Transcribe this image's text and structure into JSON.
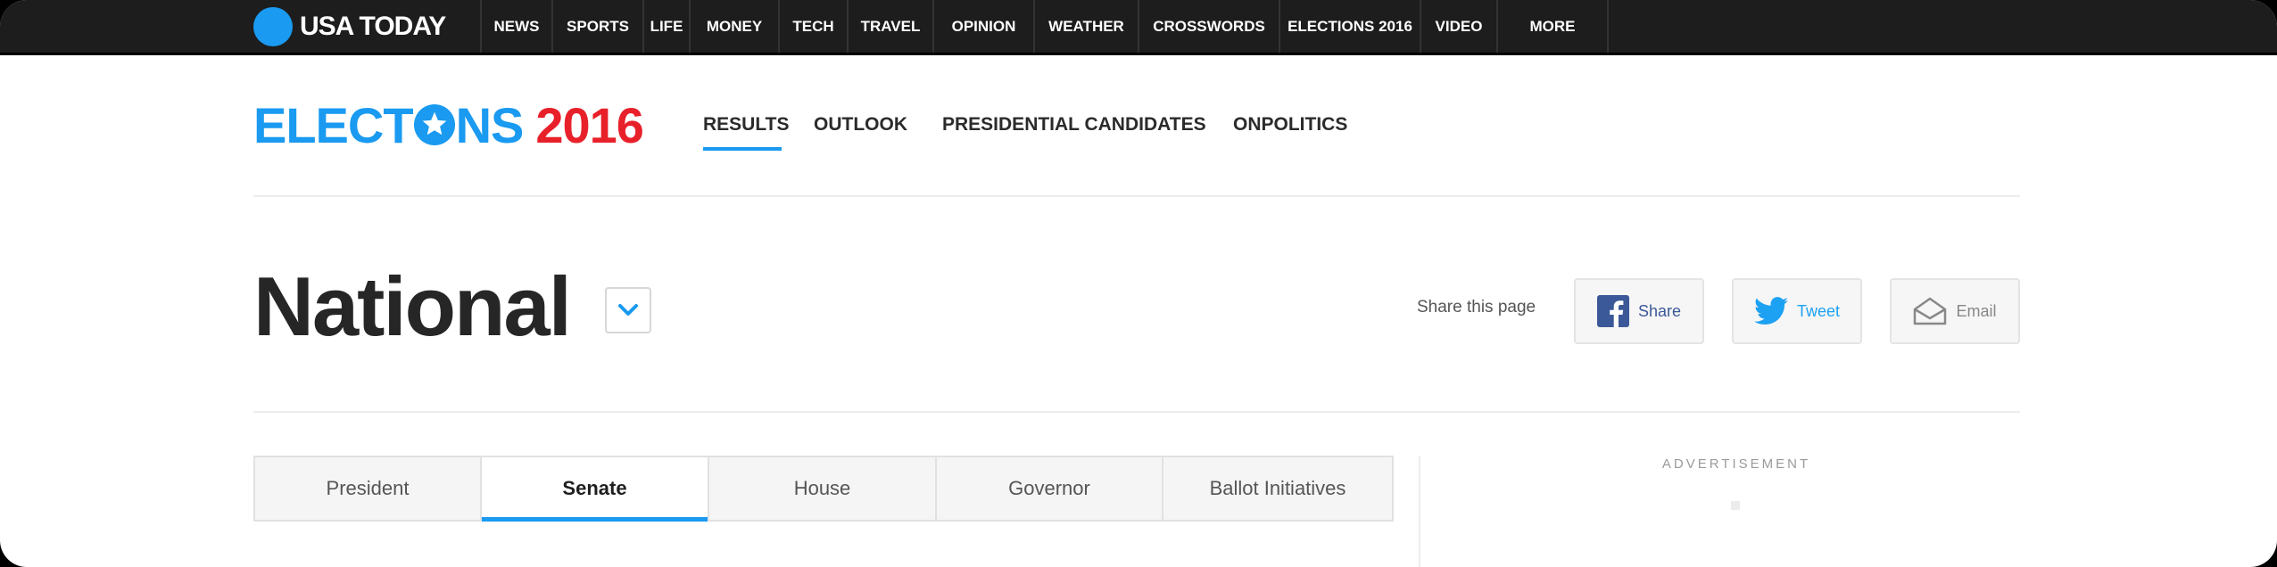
{
  "site": {
    "logo_text": "USA TODAY",
    "nav": [
      {
        "label": "NEWS"
      },
      {
        "label": "SPORTS"
      },
      {
        "label": "LIFE"
      },
      {
        "label": "MONEY"
      },
      {
        "label": "TECH"
      },
      {
        "label": "TRAVEL"
      },
      {
        "label": "OPINION"
      },
      {
        "label": "WEATHER"
      },
      {
        "label": "CROSSWORDS"
      },
      {
        "label": "ELECTIONS 2016"
      },
      {
        "label": "VIDEO"
      },
      {
        "label": "MORE"
      }
    ]
  },
  "elections": {
    "brand_left": "ELECT",
    "brand_right": "NS",
    "brand_year": "2016",
    "subnav": [
      {
        "label": "RESULTS",
        "active": true
      },
      {
        "label": "OUTLOOK"
      },
      {
        "label": "PRESIDENTIAL CANDIDATES"
      },
      {
        "label": "ONPOLITICS"
      }
    ]
  },
  "page": {
    "title": "National",
    "share_label": "Share this page",
    "share_buttons": [
      {
        "label": "Share",
        "icon": "facebook-icon"
      },
      {
        "label": "Tweet",
        "icon": "twitter-icon"
      },
      {
        "label": "Email",
        "icon": "email-icon"
      }
    ]
  },
  "race_tabs": [
    {
      "label": "President"
    },
    {
      "label": "Senate",
      "active": true
    },
    {
      "label": "House"
    },
    {
      "label": "Governor"
    },
    {
      "label": "Ballot Initiatives"
    }
  ],
  "ad": {
    "label": "ADVERTISEMENT"
  },
  "colors": {
    "accent": "#1a9af0",
    "brand_red": "#e8202a",
    "topbar": "#1d1d1d"
  }
}
